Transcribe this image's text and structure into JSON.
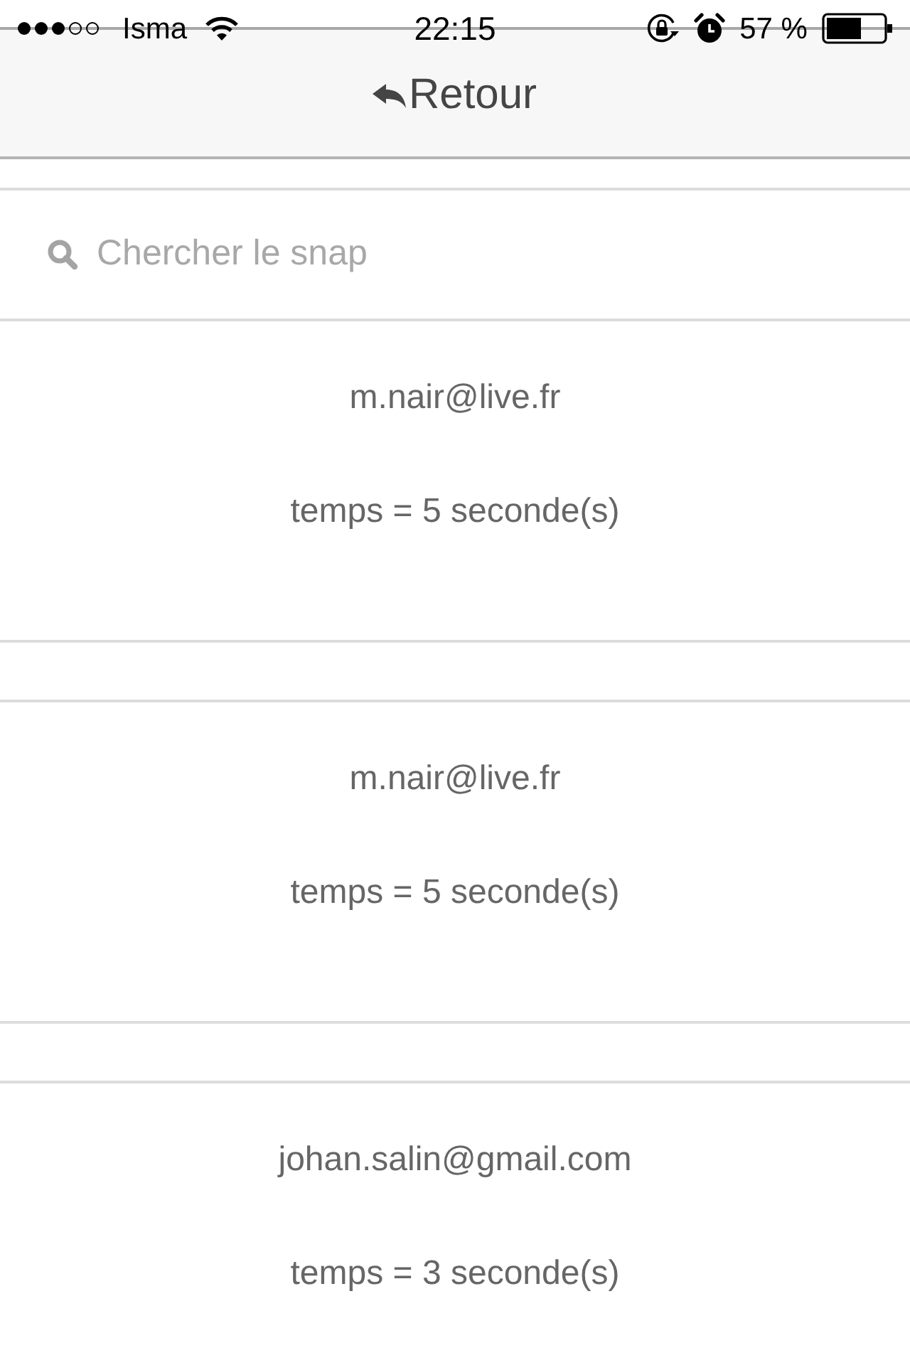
{
  "status_bar": {
    "carrier": "Isma",
    "time": "22:15",
    "battery": "57 %"
  },
  "header": {
    "back_label": "Retour"
  },
  "search": {
    "placeholder": "Chercher le snap"
  },
  "snaps": [
    {
      "email": "m.nair@live.fr",
      "duration": "temps = 5 seconde(s)"
    },
    {
      "email": "m.nair@live.fr",
      "duration": "temps = 5 seconde(s)"
    },
    {
      "email": "johan.salin@gmail.com",
      "duration": "temps = 3 seconde(s)"
    }
  ]
}
